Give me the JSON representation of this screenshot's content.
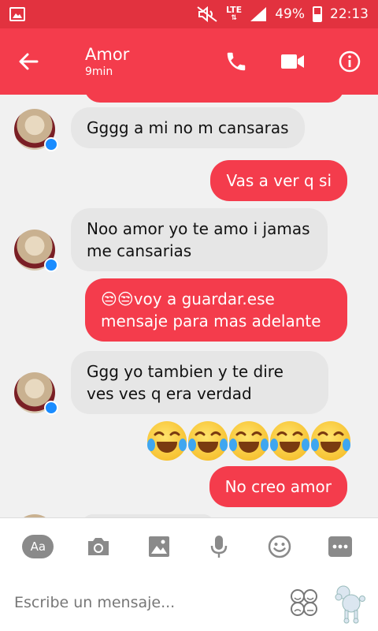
{
  "status_bar": {
    "network": "LTE",
    "battery": "49%",
    "battery_level": 0.49,
    "time": "22:13"
  },
  "header": {
    "contact_name": "Amor",
    "last_active": "9min"
  },
  "messages": [
    {
      "direction": "in",
      "text": "Gggg a mi no m cansaras"
    },
    {
      "direction": "out",
      "text": "Vas a ver q si"
    },
    {
      "direction": "in",
      "text": "Noo amor yo te amo i jamas me cansarias"
    },
    {
      "direction": "out",
      "text": "😒😒voy a guardar.ese mensaje para mas adelante"
    },
    {
      "direction": "in",
      "text": "Ggg yo tambien y te dire ves ves q era verdad"
    },
    {
      "direction": "in",
      "emoji": "laughing-with-tears-emoji",
      "count": 5
    },
    {
      "direction": "out",
      "text": "No creo amor"
    }
  ],
  "toolbar": {
    "text_button": "Aa"
  },
  "composer": {
    "placeholder": "Escribe un mensaje..."
  },
  "colors": {
    "accent": "#f43c4c",
    "status_bar": "#e2323f",
    "incoming_bubble": "#e6e6e6",
    "messenger_badge": "#1a8cff"
  }
}
